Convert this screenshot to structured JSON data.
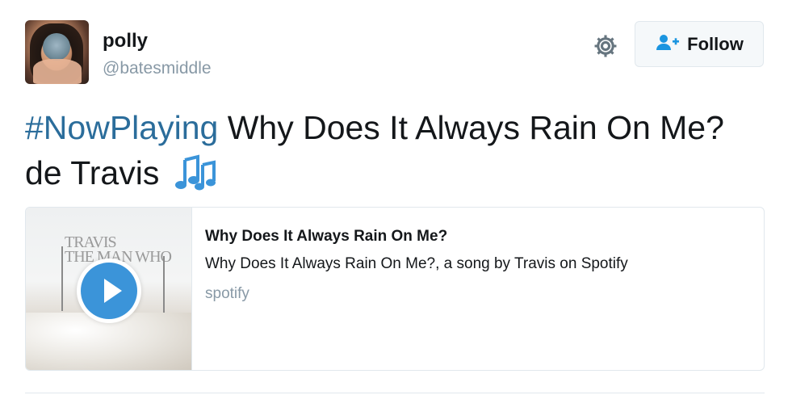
{
  "user": {
    "display_name": "polly",
    "handle": "@batesmiddle"
  },
  "actions": {
    "follow_label": "Follow"
  },
  "tweet": {
    "hashtag": "#NowPlaying",
    "text": " Why Does It Always Rain On Me? de Travis "
  },
  "card": {
    "title": "Why Does It Always Rain On Me?",
    "description": "Why Does It Always Rain On Me?, a song by Travis on Spotify",
    "domain": "spotify"
  },
  "icons": {
    "gear": "gear-icon",
    "follow": "add-user-icon",
    "notes": "musical-notes-icon",
    "play": "play-icon"
  },
  "colors": {
    "hashtag": "#2b6d9b",
    "play_button": "#3b94d9",
    "secondary_text": "#8899a6"
  }
}
